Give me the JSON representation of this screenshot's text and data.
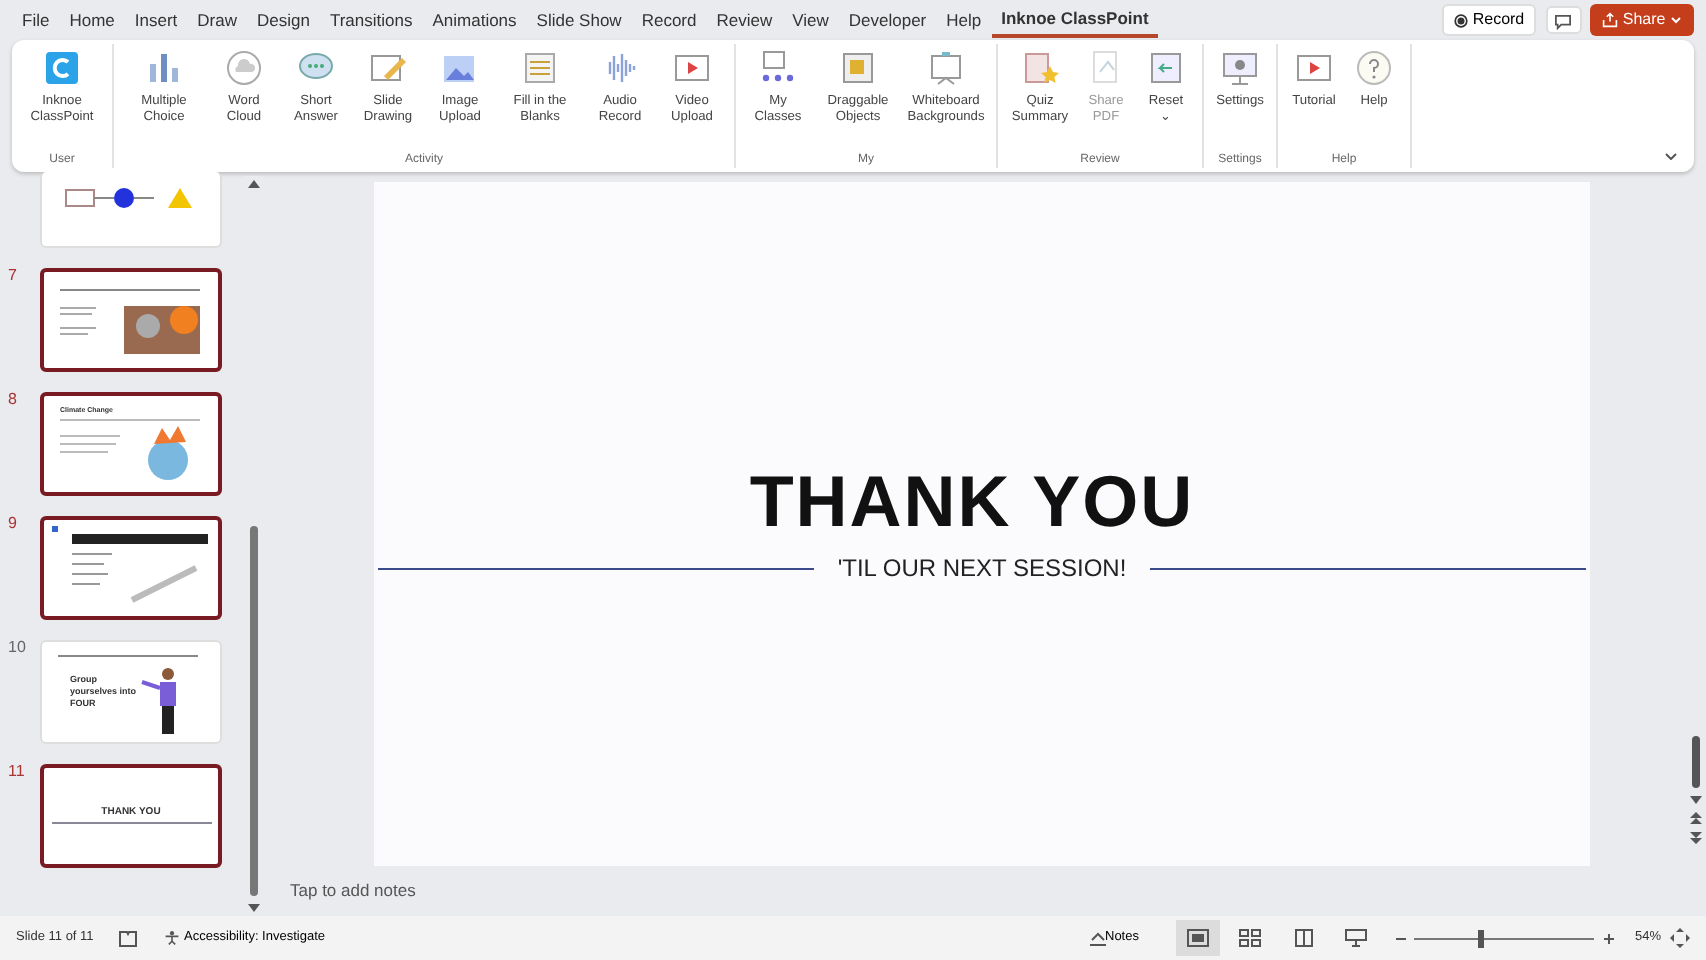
{
  "menu_tabs": [
    {
      "label": "File",
      "selected": false
    },
    {
      "label": "Home",
      "selected": false
    },
    {
      "label": "Insert",
      "selected": false
    },
    {
      "label": "Draw",
      "selected": false
    },
    {
      "label": "Design",
      "selected": false
    },
    {
      "label": "Transitions",
      "selected": false
    },
    {
      "label": "Animations",
      "selected": false
    },
    {
      "label": "Slide Show",
      "selected": false
    },
    {
      "label": "Record",
      "selected": false
    },
    {
      "label": "Review",
      "selected": false
    },
    {
      "label": "View",
      "selected": false
    },
    {
      "label": "Developer",
      "selected": false
    },
    {
      "label": "Help",
      "selected": false
    },
    {
      "label": "Inknoe ClassPoint",
      "selected": true
    }
  ],
  "top_buttons": {
    "record": "Record",
    "share": "Share"
  },
  "ribbon_groups": [
    {
      "label": "User",
      "buttons": [
        {
          "label": "Inknoe ClassPoint",
          "kind": "logo",
          "disabled": false
        }
      ]
    },
    {
      "label": "Activity",
      "buttons": [
        {
          "label": "Multiple Choice",
          "kind": "bars",
          "disabled": false
        },
        {
          "label": "Word Cloud",
          "kind": "cloud",
          "disabled": false
        },
        {
          "label": "Short Answer",
          "kind": "bubble",
          "disabled": false
        },
        {
          "label": "Slide Drawing",
          "kind": "pen",
          "disabled": false
        },
        {
          "label": "Image Upload",
          "kind": "image",
          "disabled": false
        },
        {
          "label": "Fill in the Blanks",
          "kind": "lines",
          "disabled": false
        },
        {
          "label": "Audio Record",
          "kind": "wave",
          "disabled": false
        },
        {
          "label": "Video Upload",
          "kind": "video",
          "disabled": false
        }
      ]
    },
    {
      "label": "My",
      "buttons": [
        {
          "label": "My Classes",
          "kind": "dots",
          "disabled": false
        },
        {
          "label": "Draggable Objects",
          "kind": "drag",
          "disabled": false
        },
        {
          "label": "Whiteboard Backgrounds",
          "kind": "board",
          "disabled": false
        }
      ]
    },
    {
      "label": "Review",
      "buttons": [
        {
          "label": "Quiz Summary",
          "kind": "quiz",
          "disabled": false
        },
        {
          "label": "Share PDF",
          "kind": "pdf",
          "disabled": true
        },
        {
          "label": "Reset",
          "kind": "reset",
          "disabled": false,
          "dropdown": "⌄"
        }
      ]
    },
    {
      "label": "Settings",
      "buttons": [
        {
          "label": "Settings",
          "kind": "monitor",
          "disabled": false
        }
      ]
    },
    {
      "label": "Help",
      "buttons": [
        {
          "label": "Tutorial",
          "kind": "video",
          "disabled": false
        },
        {
          "label": "Help",
          "kind": "help",
          "disabled": false
        }
      ]
    }
  ],
  "slides": [
    {
      "number": "7",
      "selected": true,
      "kind": "photo"
    },
    {
      "number": "8",
      "selected": true,
      "kind": "globe",
      "title": "Climate Change"
    },
    {
      "number": "9",
      "selected": true,
      "kind": "screen"
    },
    {
      "number": "10",
      "selected": false,
      "kind": "person",
      "text": "Group yourselves into FOUR"
    },
    {
      "number": "11",
      "selected": true,
      "kind": "text",
      "text": "THANK YOU"
    }
  ],
  "slide": {
    "title": "THANK YOU",
    "subtitle": "'TIL OUR NEXT SESSION!"
  },
  "notes_placeholder": "Tap to add notes",
  "status_bar": {
    "slide_count": "Slide 11 of 11",
    "accessibility": "Accessibility: Investigate",
    "notes": "Notes",
    "zoom": "54%",
    "zoom_level": {
      "level": 0.35
    }
  }
}
